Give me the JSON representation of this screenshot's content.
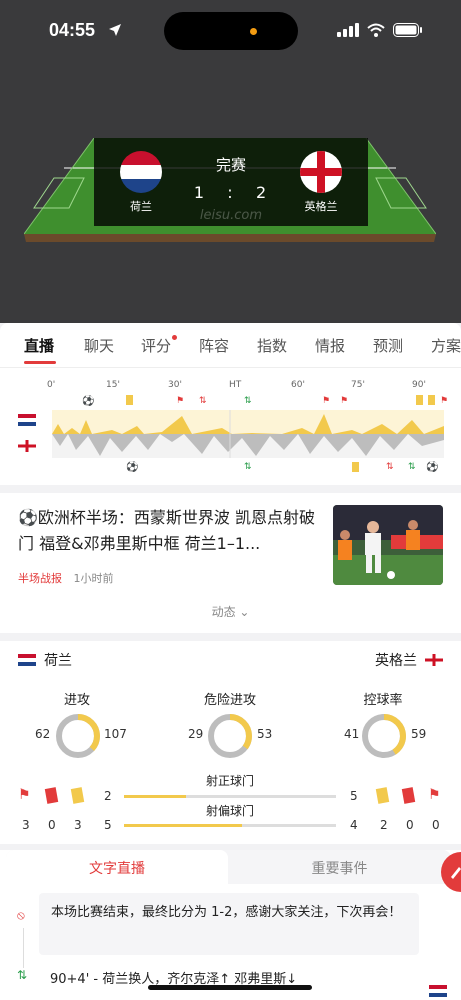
{
  "status_bar": {
    "time": "04:55"
  },
  "match": {
    "status": "完赛",
    "home": {
      "name": "荷兰",
      "score": "1"
    },
    "away": {
      "name": "英格兰",
      "score": "2"
    },
    "separator": ":",
    "watermark": "leisu.com"
  },
  "tabs": [
    "直播",
    "聊天",
    "评分",
    "阵容",
    "指数",
    "情报",
    "预测",
    "方案"
  ],
  "timeline": {
    "ticks": [
      "0'",
      "15'",
      "30'",
      "HT",
      "60'",
      "75'",
      "90'"
    ]
  },
  "news": {
    "title": "⚽欧洲杯半场：西蒙斯世界波 凯恩点射破门 福登&邓弗里斯中框 荷兰1–1...",
    "tag": "半场战报",
    "time_ago": "1小时前",
    "more": "动态 ⌄"
  },
  "stats": {
    "home_team": "荷兰",
    "away_team": "英格兰",
    "rings": [
      {
        "label": "进攻",
        "home": "62",
        "away": "107",
        "home_share": 0.37
      },
      {
        "label": "危险进攻",
        "home": "29",
        "away": "53",
        "home_share": 0.35
      },
      {
        "label": "控球率",
        "home": "41",
        "away": "59",
        "home_share": 0.41
      }
    ],
    "bars": [
      {
        "label": "射正球门",
        "home": "2",
        "away": "5",
        "home_share": 0.29
      },
      {
        "label": "射偏球门",
        "home": "5",
        "away": "4",
        "home_share": 0.56
      }
    ],
    "home_cards": [
      "3",
      "0",
      "3"
    ],
    "away_cards": [
      "2",
      "0",
      "0"
    ]
  },
  "live": {
    "tab_text": "文字直播",
    "tab_events": "重要事件",
    "message": "本场比赛结束，最终比分为 1-2，感谢大家关注，下次再会！",
    "event": "90+4' - 荷兰换人，齐尔克泽↑ 邓弗里斯↓"
  },
  "colors": {
    "accent": "#e23b3b",
    "pitch": "#3e8e2c",
    "home_bar": "#f2c94c",
    "away_bar": "#bdbdbd"
  }
}
